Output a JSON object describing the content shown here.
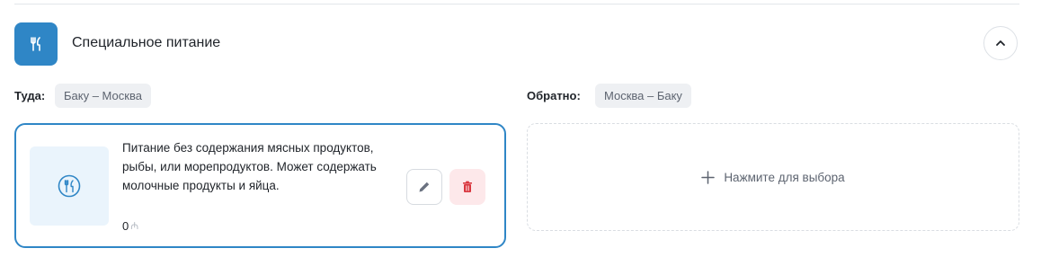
{
  "section": {
    "title": "Специальное питание",
    "icon": "utensils-icon",
    "collapse_icon": "chevron-up-icon",
    "accent_color": "#2f86c6"
  },
  "outbound": {
    "label": "Туда:",
    "route": "Баку – Москва",
    "meal": {
      "description": "Питание без содержания мясных продуктов, рыбы, или морепродуктов. Может содержать молочные продукты и яйца.",
      "price": "0",
      "currency": "₼",
      "edit_icon": "pencil-icon",
      "delete_icon": "trash-icon"
    }
  },
  "return": {
    "label": "Обратно:",
    "route": "Москва – Баку",
    "select_label": "Нажмите для выбора"
  }
}
